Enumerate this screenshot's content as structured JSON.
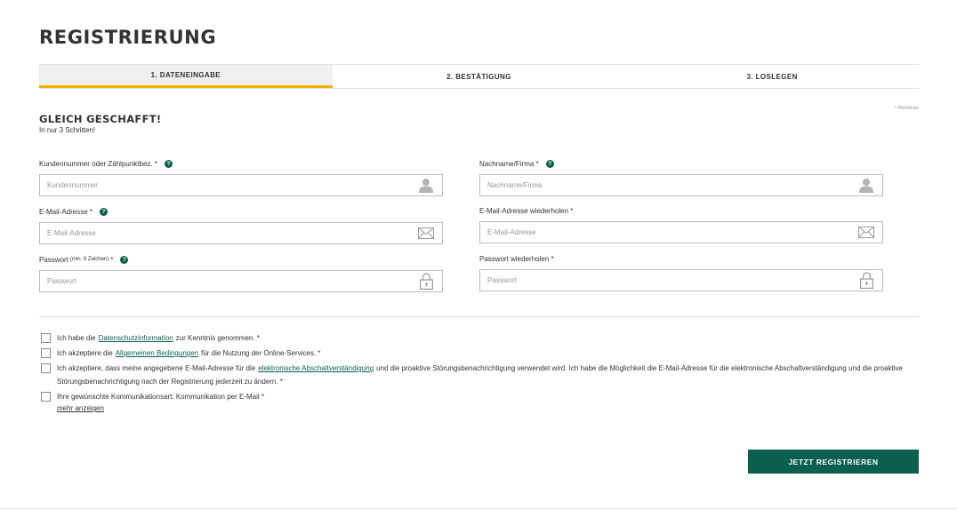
{
  "page": {
    "title": "REGISTRIERUNG"
  },
  "steps": [
    {
      "label": "1.  DATENEINGABE",
      "active": true
    },
    {
      "label": "2.  BESTÄTIGUNG",
      "active": false
    },
    {
      "label": "3.  LOSLEGEN",
      "active": false
    }
  ],
  "required_note": "* Pflichtfelds",
  "section": {
    "title": "GLEICH GESCHAFFT!",
    "subtitle": "In nur 3 Schritten!"
  },
  "fields": {
    "kundennummer": {
      "label": "Kundennummer oder Zählpunktbez. *",
      "placeholder": "Kundennummer",
      "icon": "user-icon"
    },
    "nachname": {
      "label": "Nachname/Firma *",
      "placeholder": "Nachname/Firma",
      "icon": "user-icon"
    },
    "email": {
      "label": "E-Mail-Adresse *",
      "placeholder": "E-Mail-Adresse",
      "icon": "envelope-icon"
    },
    "email_repeat": {
      "label": "E-Mail-Adresse wiederholen *",
      "placeholder": "E-Mail-Adresse",
      "icon": "envelope-icon"
    },
    "passwort": {
      "label": "Passwort",
      "label_hint": "(min. 8 Zeichen)",
      "label_suffix": "*",
      "placeholder": "Passwort",
      "icon": "lock-icon"
    },
    "passwort_repeat": {
      "label": "Passwort wiederholen *",
      "placeholder": "Passwort",
      "icon": "lock-icon"
    }
  },
  "help_glyph": "?",
  "checks": {
    "datenschutz": {
      "before": "Ich habe die",
      "link": "Datenschutzinformation",
      "after": "zur Kenntnis genommen. *"
    },
    "agb": {
      "before": "Ich akzeptiere die",
      "link": "Allgemeinen Bedingungen",
      "after": "für die Nutzung der Online-Services. *"
    },
    "abschalt": {
      "before": "Ich akzeptiere, dass meine angegebene E-Mail-Adresse für die",
      "link": "elektronische Abschaltverständigung",
      "after": "und die proaktive Störungsbenachrichtigung verwendet wird. Ich habe die Möglichkeit die E-Mail-Adresse für die elektronische Abschaltverständigung und die proaktive Störungsbenachrichtigung nach der Registrierung jederzeit zu ändern. *"
    },
    "kommunikation": {
      "text": "Ihre gewünschte Kommunikationsart: Kommunikation per E-Mail *",
      "more_link": "mehr anzeigen"
    }
  },
  "submit": {
    "label": "JETZT REGISTRIEREN"
  },
  "colors": {
    "accent": "#0b5f4d",
    "step_highlight": "#f0b400"
  }
}
